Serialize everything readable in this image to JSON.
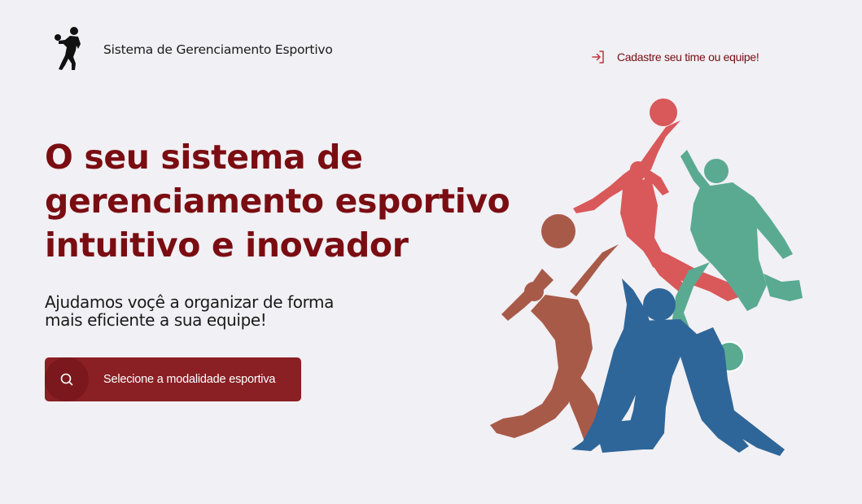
{
  "header": {
    "logo_icon": "athlete-silhouette-icon",
    "brand_title": "Sistema de Gerenciamento Esportivo",
    "signup_icon": "sign-in-arrow-icon",
    "signup_label": "Cadastre seu time ou equipe!"
  },
  "hero": {
    "title_lines": [
      "O seu sistema de",
      "gerenciamento esportivo",
      "intuitivo e inovador"
    ],
    "subtitle_lines": [
      "Ajudamos voçê a organizar de forma",
      "mais eficiente a sua equipe!"
    ],
    "cta_icon": "search-icon",
    "cta_label": "Selecione a modalidade esportiva",
    "illustration": "sports-players-illustration"
  },
  "colors": {
    "background": "#f1f0f4",
    "brand": "#7a0d12",
    "button": "#8a1f24",
    "blue_player": "#2f6699",
    "green_player": "#5aaa92",
    "red_player": "#d9585a",
    "brown_player": "#a85a48"
  }
}
